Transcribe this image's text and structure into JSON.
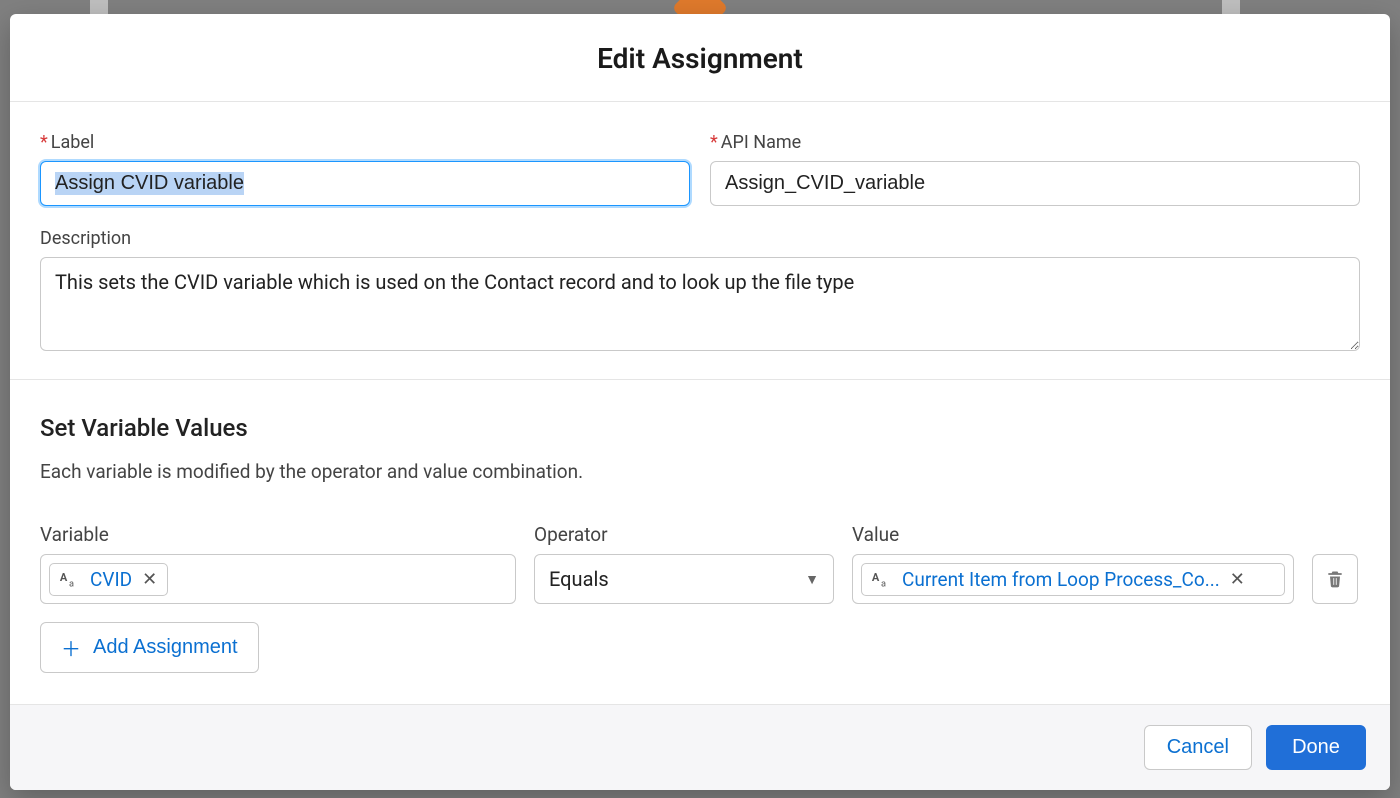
{
  "modal": {
    "title": "Edit Assignment",
    "labels": {
      "label": "Label",
      "api_name": "API Name",
      "description": "Description"
    },
    "values": {
      "label": "Assign CVID variable",
      "api_name": "Assign_CVID_variable",
      "description": "This sets the CVID variable which is used on the Contact record and to look up the file type"
    }
  },
  "section": {
    "title": "Set Variable Values",
    "subtitle": "Each variable is modified by the operator and value combination.",
    "columns": {
      "variable": "Variable",
      "operator": "Operator",
      "value": "Value"
    },
    "row": {
      "variable_pill": "CVID",
      "operator": "Equals",
      "value_pill": "Current Item from Loop Process_Co..."
    },
    "add_button": "Add Assignment"
  },
  "footer": {
    "cancel": "Cancel",
    "done": "Done"
  }
}
